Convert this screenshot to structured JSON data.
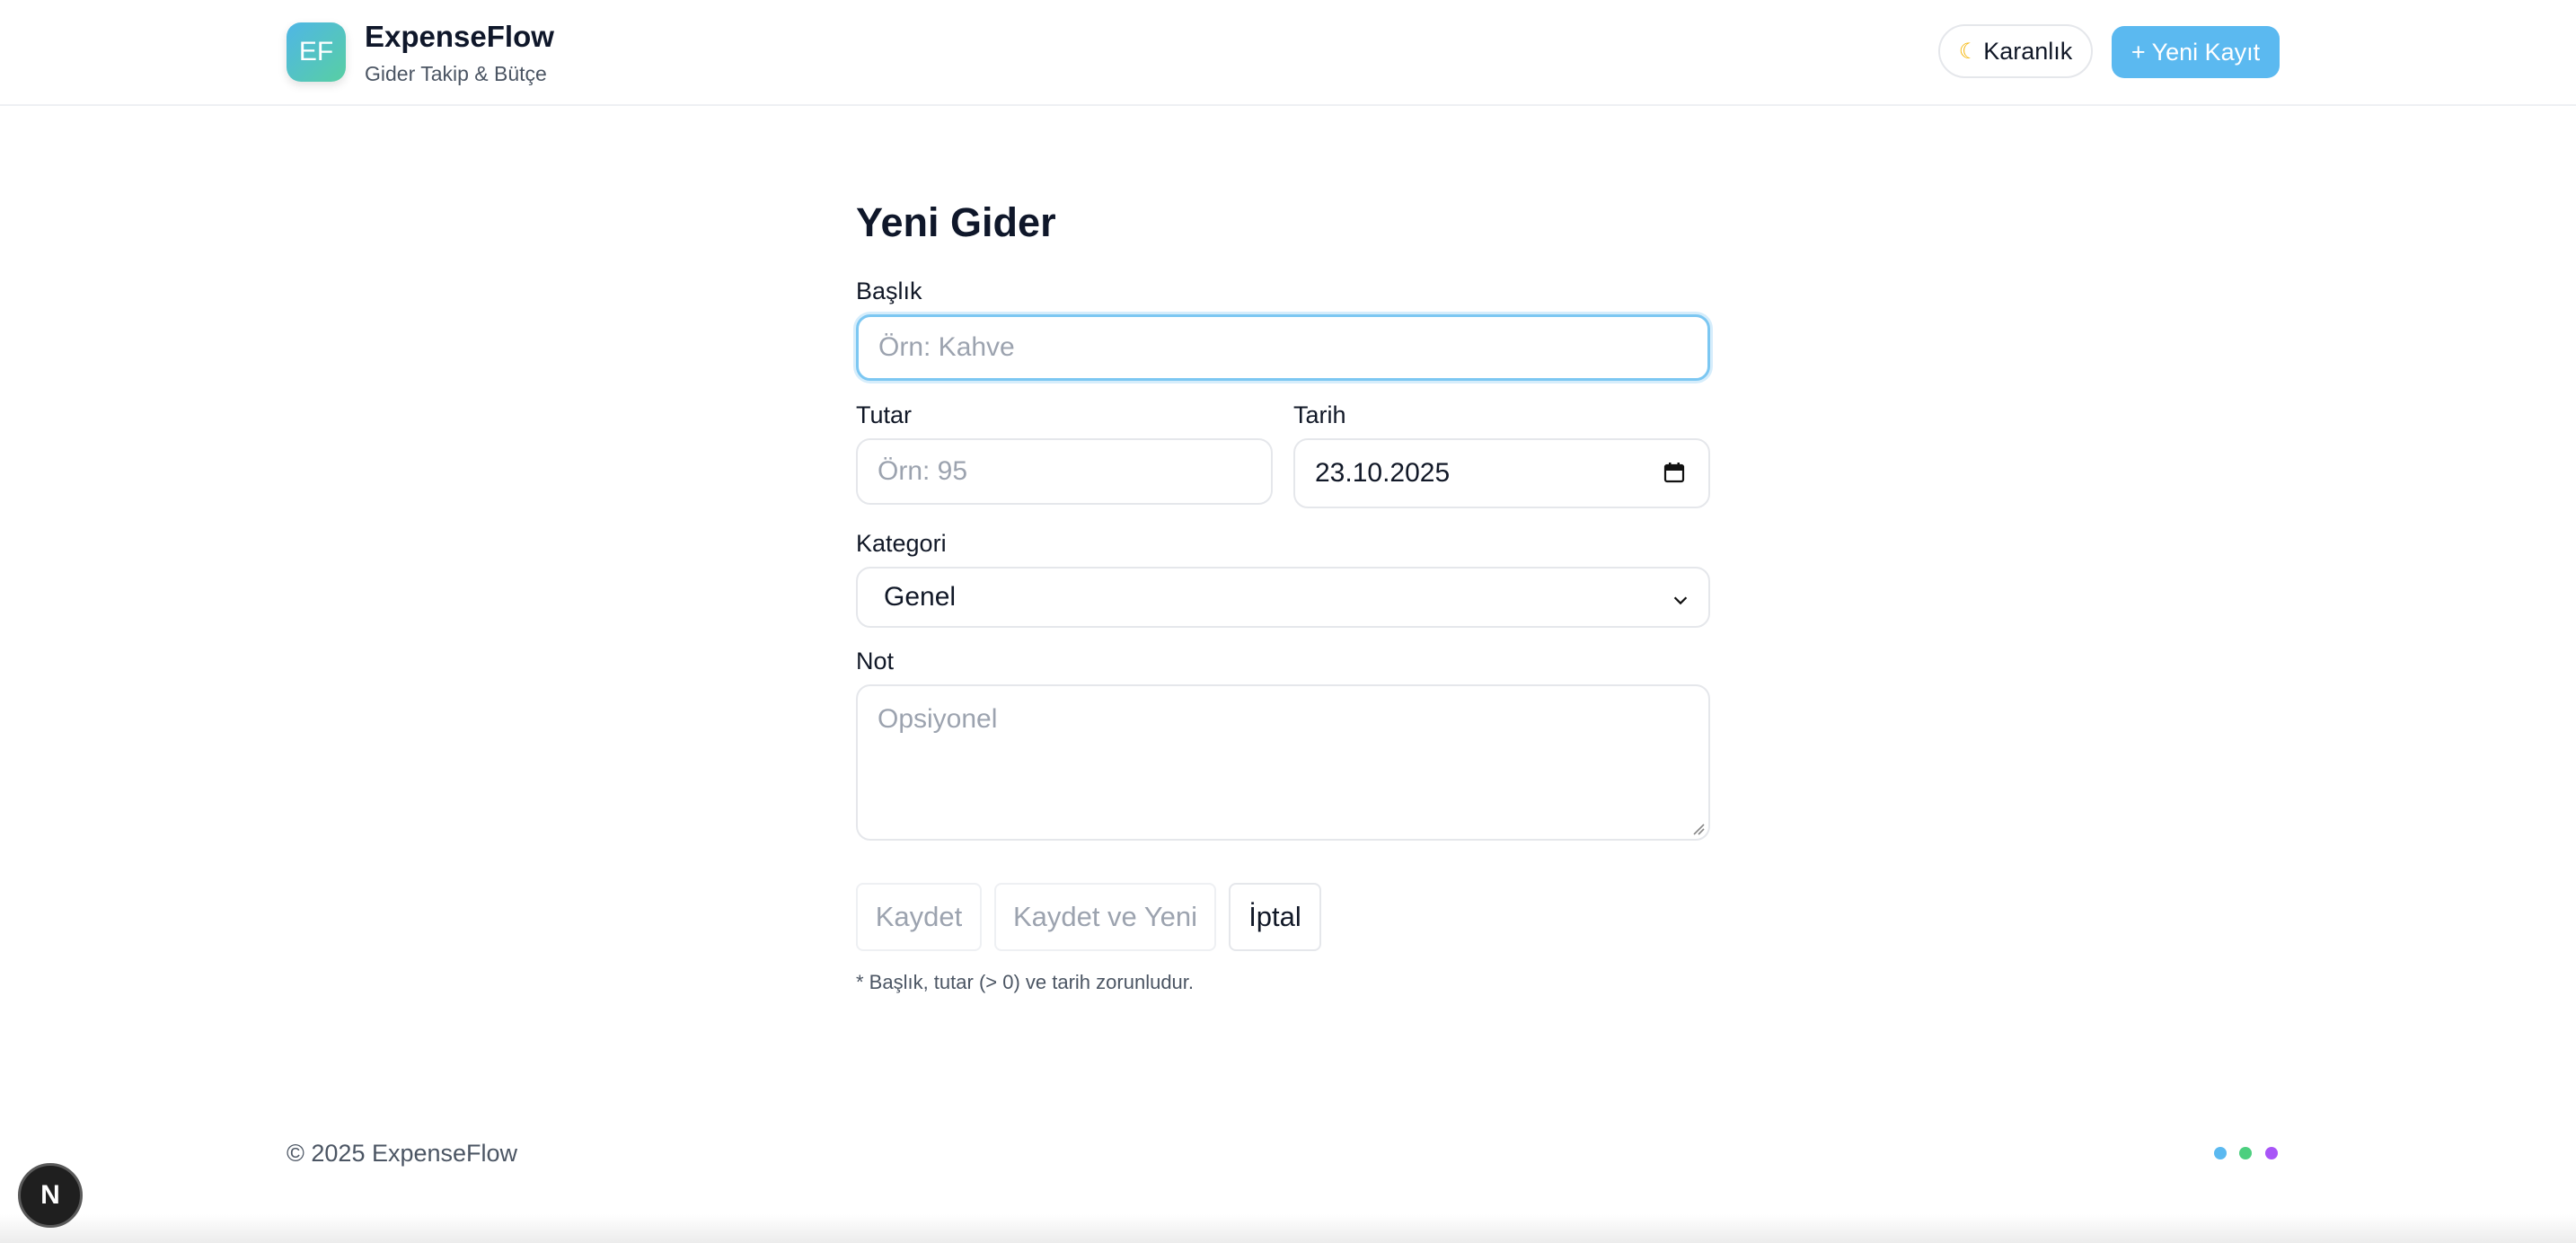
{
  "header": {
    "logo_text": "EF",
    "brand_name": "ExpenseFlow",
    "brand_subtitle": "Gider Takip & Bütçe",
    "theme_button_label": "Karanlık",
    "theme_icon": "moon-icon",
    "new_record_label": "+ Yeni Kayıt",
    "accent_color": "#5bb9f0"
  },
  "form": {
    "title": "Yeni Gider",
    "title_label": "Başlık",
    "title_placeholder": "Örn: Kahve",
    "amount_label": "Tutar",
    "amount_placeholder": "Örn: 95",
    "date_label": "Tarih",
    "date_value": "23.10.2025",
    "category_label": "Kategori",
    "category_value": "Genel",
    "note_label": "Not",
    "note_placeholder": "Opsiyonel",
    "save_label": "Kaydet",
    "save_new_label": "Kaydet ve Yeni",
    "cancel_label": "İptal",
    "hint": "* Başlık, tutar (> 0) ve tarih zorunludur."
  },
  "footer": {
    "copyright": "© 2025 ExpenseFlow",
    "dot_colors": [
      "#5bb9f0",
      "#4ccf7f",
      "#a855f7"
    ]
  },
  "dev_badge": "N"
}
